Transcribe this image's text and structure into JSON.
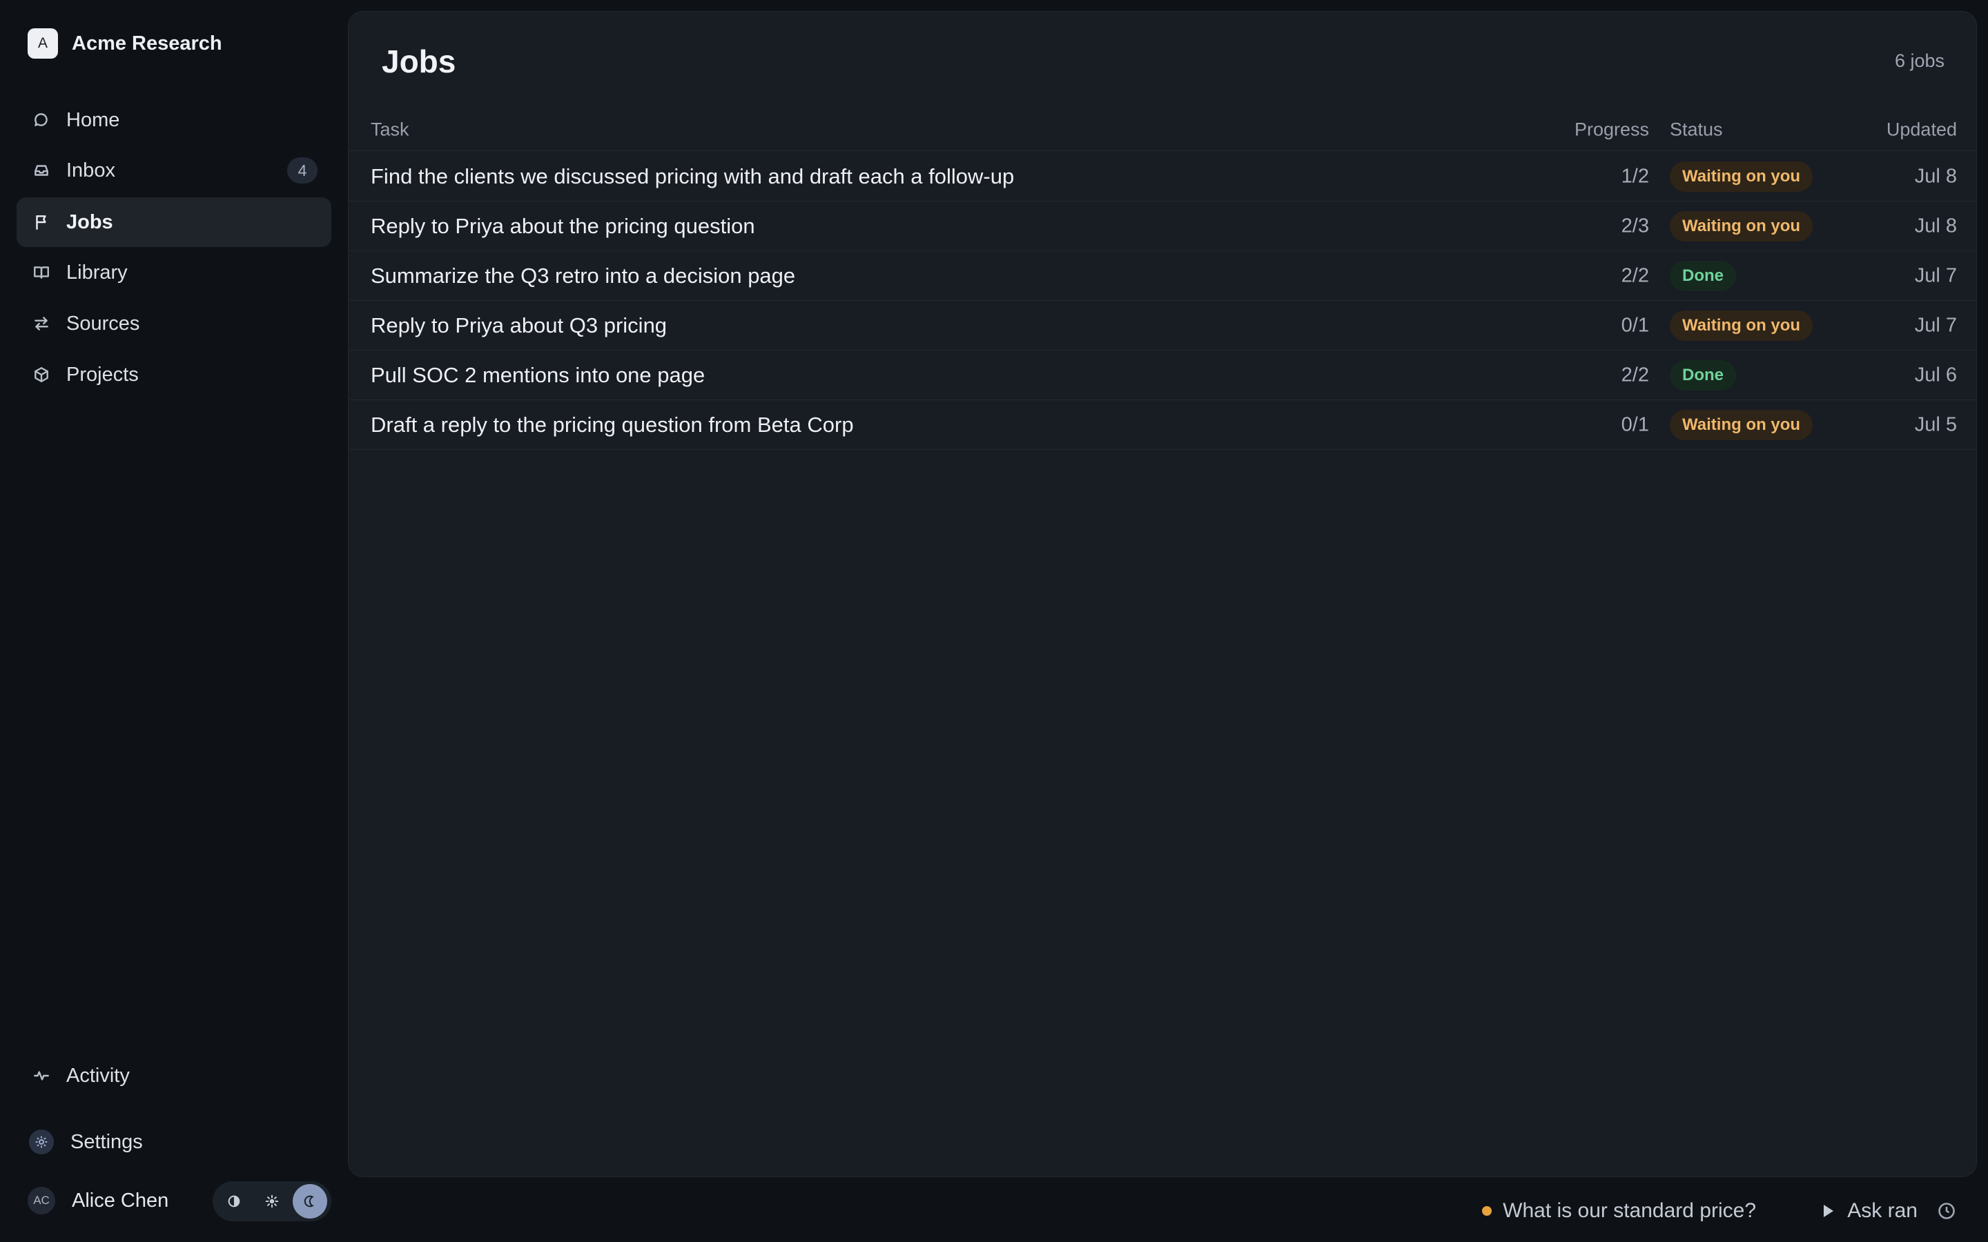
{
  "brand": {
    "logo_letter": "A",
    "name": "Acme Research"
  },
  "nav": {
    "home": "Home",
    "inbox": "Inbox",
    "inbox_badge": "4",
    "jobs": "Jobs",
    "library": "Library",
    "sources": "Sources",
    "projects": "Projects",
    "activity": "Activity",
    "settings": "Settings"
  },
  "user": {
    "initials": "AC",
    "name": "Alice Chen"
  },
  "theme": {
    "selected": "dark"
  },
  "main": {
    "title": "Jobs",
    "count": "6 jobs",
    "columns": {
      "task": "Task",
      "progress": "Progress",
      "status": "Status",
      "updated": "Updated"
    },
    "rows": [
      {
        "task": "Find the clients we discussed pricing with and draft each a follow-up",
        "progress": "1/2",
        "status": "Waiting on you",
        "updated": "Jul 8"
      },
      {
        "task": "Reply to Priya about the pricing question",
        "progress": "2/3",
        "status": "Waiting on you",
        "updated": "Jul 8"
      },
      {
        "task": "Summarize the Q3 retro into a decision page",
        "progress": "2/2",
        "status": "Done",
        "updated": "Jul 7"
      },
      {
        "task": "Reply to Priya about Q3 pricing",
        "progress": "0/1",
        "status": "Waiting on you",
        "updated": "Jul 7"
      },
      {
        "task": "Pull SOC 2 mentions into one page",
        "progress": "2/2",
        "status": "Done",
        "updated": "Jul 6"
      },
      {
        "task": "Draft a reply to the pricing question from Beta Corp",
        "progress": "0/1",
        "status": "Waiting on you",
        "updated": "Jul 5"
      }
    ]
  },
  "statusbar": {
    "question": "What is our standard price?",
    "run_label": "Ask ran"
  },
  "colors": {
    "waiting": "#f0b86a",
    "done": "#6fd39a",
    "accent_dot": "#e8a33c"
  }
}
